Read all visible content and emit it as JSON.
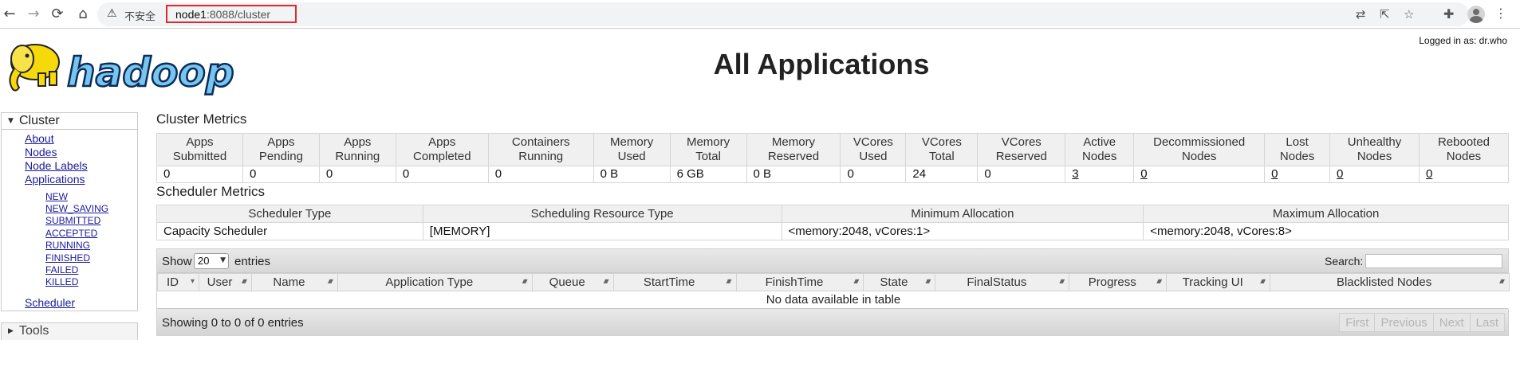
{
  "browser": {
    "insecure_label": "不安全",
    "url_host": "node1",
    "url_path": ":8088/cluster"
  },
  "header": {
    "logo_text": "hadoop",
    "page_title": "All Applications",
    "logged_in": "Logged in as: dr.who"
  },
  "nav": {
    "cluster_title": "Cluster",
    "links": [
      "About",
      "Nodes",
      "Node Labels",
      "Applications"
    ],
    "app_states": [
      "NEW",
      "NEW_SAVING",
      "SUBMITTED",
      "ACCEPTED",
      "RUNNING",
      "FINISHED",
      "FAILED",
      "KILLED"
    ],
    "scheduler": "Scheduler",
    "tools_title": "Tools"
  },
  "cluster_metrics": {
    "title": "Cluster Metrics",
    "headers": [
      "Apps Submitted",
      "Apps Pending",
      "Apps Running",
      "Apps Completed",
      "Containers Running",
      "Memory Used",
      "Memory Total",
      "Memory Reserved",
      "VCores Used",
      "VCores Total",
      "VCores Reserved",
      "Active Nodes",
      "Decommissioned Nodes",
      "Lost Nodes",
      "Unhealthy Nodes",
      "Rebooted Nodes"
    ],
    "values": [
      "0",
      "0",
      "0",
      "0",
      "0",
      "0 B",
      "6 GB",
      "0 B",
      "0",
      "24",
      "0",
      "3",
      "0",
      "0",
      "0",
      "0"
    ]
  },
  "scheduler_metrics": {
    "title": "Scheduler Metrics",
    "headers": [
      "Scheduler Type",
      "Scheduling Resource Type",
      "Minimum Allocation",
      "Maximum Allocation"
    ],
    "values": [
      "Capacity Scheduler",
      "[MEMORY]",
      "<memory:2048, vCores:1>",
      "<memory:2048, vCores:8>"
    ]
  },
  "apps_table": {
    "show_label": "Show",
    "page_size": "20",
    "entries_label": "entries",
    "search_label": "Search:",
    "columns": [
      "ID",
      "User",
      "Name",
      "Application Type",
      "Queue",
      "StartTime",
      "FinishTime",
      "State",
      "FinalStatus",
      "Progress",
      "Tracking UI",
      "Blacklisted Nodes"
    ],
    "empty_message": "No data available in table",
    "info": "Showing 0 to 0 of 0 entries",
    "pager": [
      "First",
      "Previous",
      "Next",
      "Last"
    ]
  }
}
